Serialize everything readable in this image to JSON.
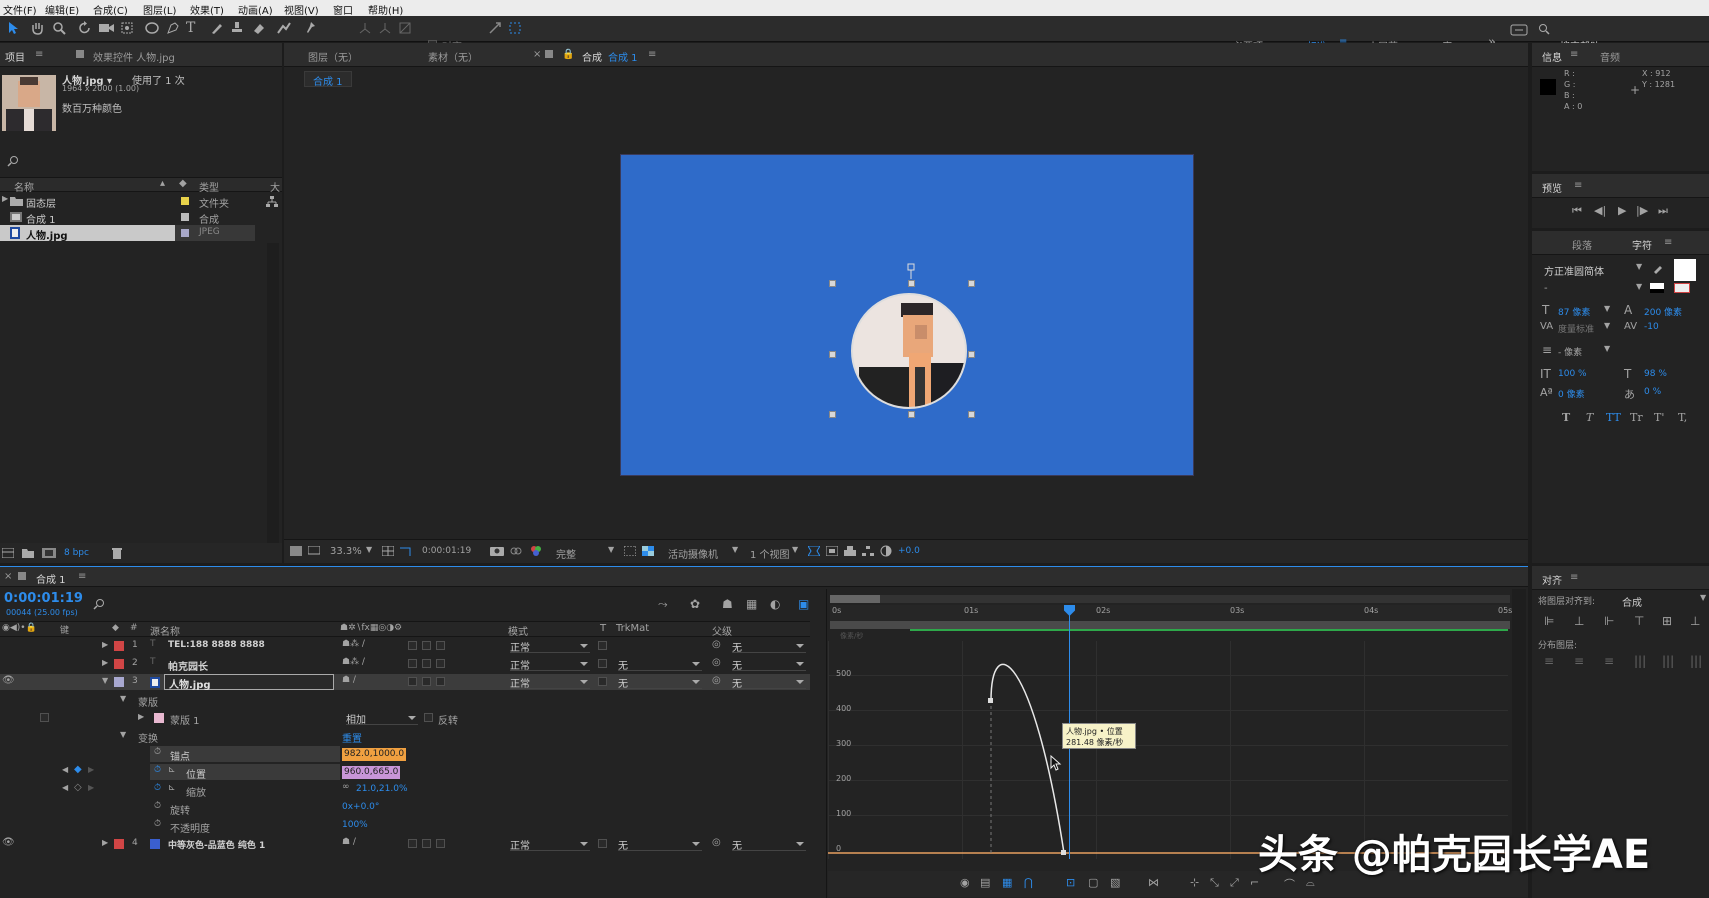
{
  "menu": [
    "文件(F)",
    "编辑(E)",
    "合成(C)",
    "图层(L)",
    "效果(T)",
    "动画(A)",
    "视图(V)",
    "窗口",
    "帮助(H)"
  ],
  "toolbar": {
    "align_label": "对齐",
    "workspaces": [
      "必要项",
      "标准",
      "小屏幕",
      "库"
    ],
    "search_help": "搜索帮助"
  },
  "project": {
    "tab": "项目",
    "effects_tab": "效果控件 人物.jpg",
    "item_name": "人物.jpg ▾",
    "usage": "使用了 1 次",
    "dims": "1964 x 2000 (1.00)",
    "color_info": "数百万种颜色",
    "col_name": "名称",
    "col_type": "类型",
    "col_size": "大",
    "items": [
      {
        "name": "固态层",
        "type": "文件夹",
        "color": "#e8d24a"
      },
      {
        "name": "合成 1",
        "type": "合成",
        "color": "#bcbcbc"
      },
      {
        "name": "人物.jpg",
        "type": "JPEG",
        "color": "#a8a8c8"
      }
    ],
    "bpc": "8 bpc"
  },
  "viewer": {
    "tabs": [
      "图层（无）",
      "素材（无）"
    ],
    "comp_tab": "合成",
    "comp_tab_name": "合成 1",
    "crumb": "合成 1",
    "zoom": "33.3%",
    "timecode": "0:00:01:19",
    "quality": "完整",
    "camera": "活动摄像机",
    "views": "1 个视图",
    "exposure": "+0.0",
    "bg_color": "#2f6bc9"
  },
  "info": {
    "tab": "信息",
    "audio_tab": "音频",
    "r": "R :",
    "g": "G :",
    "b": "B :",
    "a": "A : 0",
    "x": "X : 912",
    "y": "Y : 1281"
  },
  "preview": {
    "tab": "预览"
  },
  "character": {
    "para_tab": "段落",
    "char_tab": "字符",
    "font": "方正准圆简体",
    "style": "-",
    "size": "87 像素",
    "leading": "200 像素",
    "kerning": "度量标准",
    "tracking": "-10",
    "stroke": "- 像素",
    "vscale": "100 %",
    "hscale": "98 %",
    "baseline": "0 像素",
    "tsume": "0 %",
    "fmt": [
      "T",
      "T",
      "TT",
      "Tr",
      "T'",
      "T,"
    ]
  },
  "align": {
    "tab": "对齐",
    "align_to_label": "将图层对齐到:",
    "align_to": "合成",
    "distribute": "分布图层:"
  },
  "timeline": {
    "tab": "合成 1",
    "timecode": "0:00:01:19",
    "frame_info": "00044 (25.00 fps)",
    "col_src": "源名称",
    "col_mode": "模式",
    "col_t": "T",
    "col_trkmat": "TrkMat",
    "col_parent": "父级",
    "layers": [
      {
        "num": "1",
        "name": "TEL:188 8888 8888",
        "mode": "正常",
        "trk": "",
        "parent": "无",
        "color": "#d04545"
      },
      {
        "num": "2",
        "name": "帕克园长",
        "mode": "正常",
        "trk": "无",
        "parent": "无",
        "color": "#d04545"
      },
      {
        "num": "3",
        "name": "人物.jpg",
        "mode": "正常",
        "trk": "无",
        "parent": "无",
        "color": "#a8a8d0"
      },
      {
        "num": "4",
        "name": "中等灰色-品蓝色 纯色 1",
        "mode": "正常",
        "trk": "无",
        "parent": "无",
        "color": "#3a5fcf"
      }
    ],
    "mask_group": "蒙版",
    "mask_name": "蒙版 1",
    "mask_mode": "相加",
    "mask_invert": "反转",
    "transform": "变换",
    "reset": "重置",
    "props": [
      {
        "label": "锚点",
        "value": "982.0,1000.0"
      },
      {
        "label": "位置",
        "value": "960.0,665.0"
      },
      {
        "label": "缩放",
        "value": "21.0,21.0%"
      },
      {
        "label": "旋转",
        "value": "0x+0.0°"
      },
      {
        "label": "不透明度",
        "value": "100%"
      }
    ],
    "ruler": [
      "0s",
      "01s",
      "02s",
      "03s",
      "04s",
      "05s"
    ],
    "graph_y": [
      "500",
      "400",
      "300",
      "200",
      "100",
      "0"
    ],
    "graph_y_unit": "像素/秒",
    "tooltip_line1": "人物.jpg • 位置",
    "tooltip_line2": "281.48 像素/秒"
  },
  "watermark": "头条 @帕克园长学AE"
}
